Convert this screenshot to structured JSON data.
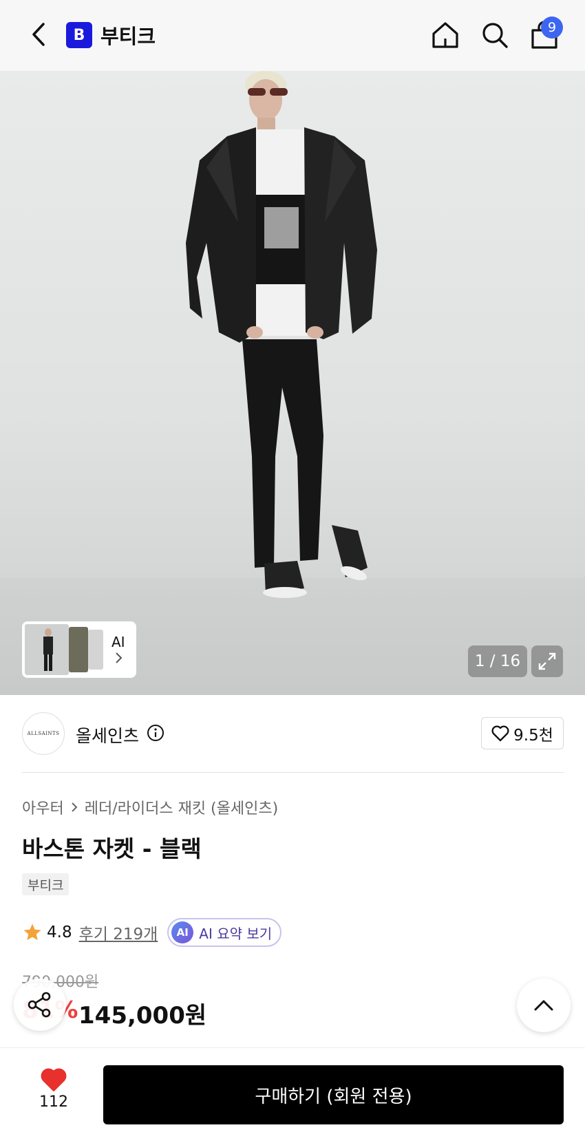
{
  "header": {
    "logo_letter": "B",
    "title": "부티크",
    "cart_count": "9",
    "icons": [
      "back-arrow-icon",
      "home-icon",
      "search-icon",
      "shopping-bag-icon"
    ]
  },
  "gallery": {
    "thumb_label": "AI",
    "counter": "1 / 16"
  },
  "brand": {
    "logo_text": "ALLSAINTS",
    "name": "올세인츠",
    "likes": "9.5천"
  },
  "product": {
    "breadcrumb": [
      "아우터",
      "레더/라이더스 재킷 (올세인츠)"
    ],
    "title": "바스톤 자켓 - 블랙",
    "tag": "부티크",
    "rating": "4.8",
    "review_link": "후기 219개",
    "ai_badge": "AI",
    "ai_summary": "AI 요약 보기",
    "original_price": "790,000원",
    "discount": "81%",
    "price": "145,000원"
  },
  "bottom_bar": {
    "wish_count": "112",
    "buy_label": "구매하기 (회원 전용)"
  },
  "colors": {
    "brand_blue": "#1a1adc",
    "badge_blue": "#3c66f0",
    "discount_red": "#f03e3e",
    "heart_red": "#e8302c"
  }
}
